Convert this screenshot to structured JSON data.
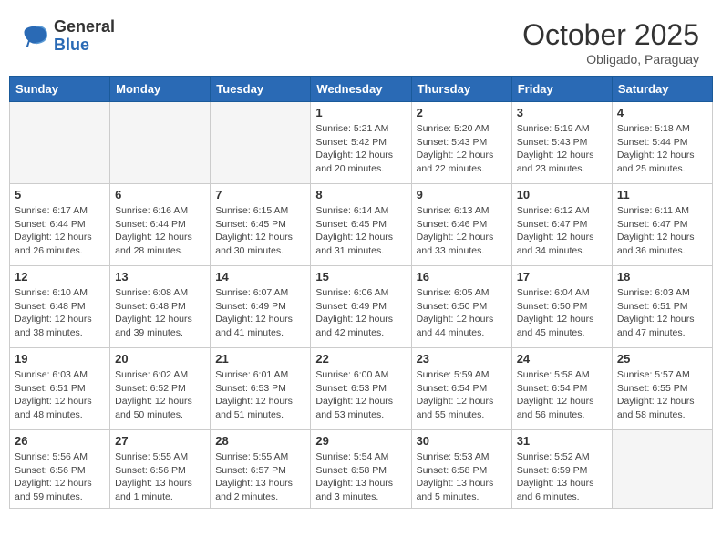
{
  "header": {
    "logo_general": "General",
    "logo_blue": "Blue",
    "month": "October 2025",
    "location": "Obligado, Paraguay"
  },
  "days_of_week": [
    "Sunday",
    "Monday",
    "Tuesday",
    "Wednesday",
    "Thursday",
    "Friday",
    "Saturday"
  ],
  "weeks": [
    [
      {
        "day": "",
        "info": ""
      },
      {
        "day": "",
        "info": ""
      },
      {
        "day": "",
        "info": ""
      },
      {
        "day": "1",
        "info": "Sunrise: 5:21 AM\nSunset: 5:42 PM\nDaylight: 12 hours\nand 20 minutes."
      },
      {
        "day": "2",
        "info": "Sunrise: 5:20 AM\nSunset: 5:43 PM\nDaylight: 12 hours\nand 22 minutes."
      },
      {
        "day": "3",
        "info": "Sunrise: 5:19 AM\nSunset: 5:43 PM\nDaylight: 12 hours\nand 23 minutes."
      },
      {
        "day": "4",
        "info": "Sunrise: 5:18 AM\nSunset: 5:44 PM\nDaylight: 12 hours\nand 25 minutes."
      }
    ],
    [
      {
        "day": "5",
        "info": "Sunrise: 6:17 AM\nSunset: 6:44 PM\nDaylight: 12 hours\nand 26 minutes."
      },
      {
        "day": "6",
        "info": "Sunrise: 6:16 AM\nSunset: 6:44 PM\nDaylight: 12 hours\nand 28 minutes."
      },
      {
        "day": "7",
        "info": "Sunrise: 6:15 AM\nSunset: 6:45 PM\nDaylight: 12 hours\nand 30 minutes."
      },
      {
        "day": "8",
        "info": "Sunrise: 6:14 AM\nSunset: 6:45 PM\nDaylight: 12 hours\nand 31 minutes."
      },
      {
        "day": "9",
        "info": "Sunrise: 6:13 AM\nSunset: 6:46 PM\nDaylight: 12 hours\nand 33 minutes."
      },
      {
        "day": "10",
        "info": "Sunrise: 6:12 AM\nSunset: 6:47 PM\nDaylight: 12 hours\nand 34 minutes."
      },
      {
        "day": "11",
        "info": "Sunrise: 6:11 AM\nSunset: 6:47 PM\nDaylight: 12 hours\nand 36 minutes."
      }
    ],
    [
      {
        "day": "12",
        "info": "Sunrise: 6:10 AM\nSunset: 6:48 PM\nDaylight: 12 hours\nand 38 minutes."
      },
      {
        "day": "13",
        "info": "Sunrise: 6:08 AM\nSunset: 6:48 PM\nDaylight: 12 hours\nand 39 minutes."
      },
      {
        "day": "14",
        "info": "Sunrise: 6:07 AM\nSunset: 6:49 PM\nDaylight: 12 hours\nand 41 minutes."
      },
      {
        "day": "15",
        "info": "Sunrise: 6:06 AM\nSunset: 6:49 PM\nDaylight: 12 hours\nand 42 minutes."
      },
      {
        "day": "16",
        "info": "Sunrise: 6:05 AM\nSunset: 6:50 PM\nDaylight: 12 hours\nand 44 minutes."
      },
      {
        "day": "17",
        "info": "Sunrise: 6:04 AM\nSunset: 6:50 PM\nDaylight: 12 hours\nand 45 minutes."
      },
      {
        "day": "18",
        "info": "Sunrise: 6:03 AM\nSunset: 6:51 PM\nDaylight: 12 hours\nand 47 minutes."
      }
    ],
    [
      {
        "day": "19",
        "info": "Sunrise: 6:03 AM\nSunset: 6:51 PM\nDaylight: 12 hours\nand 48 minutes."
      },
      {
        "day": "20",
        "info": "Sunrise: 6:02 AM\nSunset: 6:52 PM\nDaylight: 12 hours\nand 50 minutes."
      },
      {
        "day": "21",
        "info": "Sunrise: 6:01 AM\nSunset: 6:53 PM\nDaylight: 12 hours\nand 51 minutes."
      },
      {
        "day": "22",
        "info": "Sunrise: 6:00 AM\nSunset: 6:53 PM\nDaylight: 12 hours\nand 53 minutes."
      },
      {
        "day": "23",
        "info": "Sunrise: 5:59 AM\nSunset: 6:54 PM\nDaylight: 12 hours\nand 55 minutes."
      },
      {
        "day": "24",
        "info": "Sunrise: 5:58 AM\nSunset: 6:54 PM\nDaylight: 12 hours\nand 56 minutes."
      },
      {
        "day": "25",
        "info": "Sunrise: 5:57 AM\nSunset: 6:55 PM\nDaylight: 12 hours\nand 58 minutes."
      }
    ],
    [
      {
        "day": "26",
        "info": "Sunrise: 5:56 AM\nSunset: 6:56 PM\nDaylight: 12 hours\nand 59 minutes."
      },
      {
        "day": "27",
        "info": "Sunrise: 5:55 AM\nSunset: 6:56 PM\nDaylight: 13 hours\nand 1 minute."
      },
      {
        "day": "28",
        "info": "Sunrise: 5:55 AM\nSunset: 6:57 PM\nDaylight: 13 hours\nand 2 minutes."
      },
      {
        "day": "29",
        "info": "Sunrise: 5:54 AM\nSunset: 6:58 PM\nDaylight: 13 hours\nand 3 minutes."
      },
      {
        "day": "30",
        "info": "Sunrise: 5:53 AM\nSunset: 6:58 PM\nDaylight: 13 hours\nand 5 minutes."
      },
      {
        "day": "31",
        "info": "Sunrise: 5:52 AM\nSunset: 6:59 PM\nDaylight: 13 hours\nand 6 minutes."
      },
      {
        "day": "",
        "info": ""
      }
    ]
  ]
}
